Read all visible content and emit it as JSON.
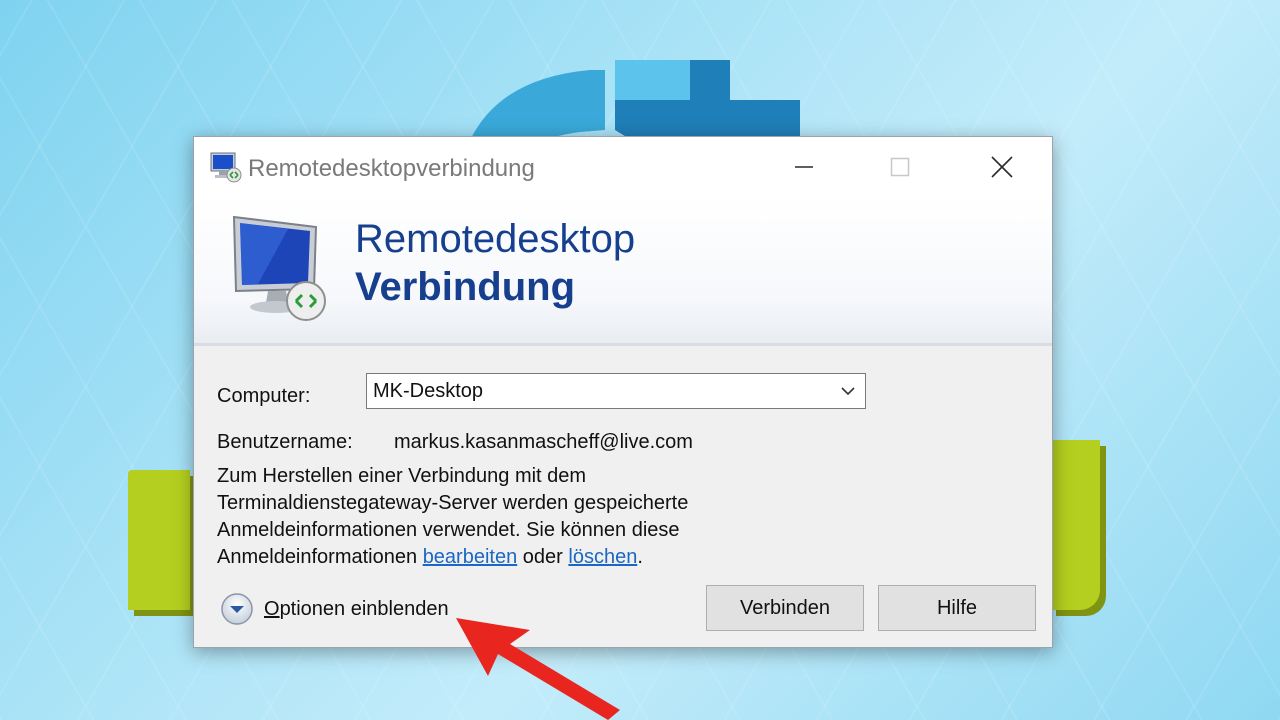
{
  "window": {
    "title": "Remotedesktopverbindung",
    "controls": [
      "minimize",
      "maximize",
      "close"
    ]
  },
  "banner": {
    "line1": "Remotedesktop",
    "line2": "Verbindung"
  },
  "form": {
    "computer_label": "Computer:",
    "computer_value": "MK-Desktop",
    "username_label": "Benutzername:",
    "username_value": "markus.kasanmascheff@live.com",
    "info_text": "Zum Herstellen einer Verbindung mit dem Terminaldienstegateway-Server werden gespeicherte Anmeldeinformationen verwendet. Sie können diese Anmeldeinformationen",
    "link_edit": "bearbeiten",
    "conjunction": "oder",
    "link_delete": "löschen",
    "period": "."
  },
  "footer": {
    "options_label_first": "O",
    "options_label_rest": "ptionen einblenden",
    "connect_label": "Verbinden",
    "help_label": "Hilfe"
  },
  "icons": {
    "title": "remote-desktop-icon",
    "banner": "remote-desktop-monitor-icon",
    "options": "chevron-down-circle-icon",
    "combo": "chevron-down-icon"
  },
  "colors": {
    "banner_text": "#163f8e",
    "link": "#1b68c4",
    "annotation_arrow": "#e8261f"
  }
}
